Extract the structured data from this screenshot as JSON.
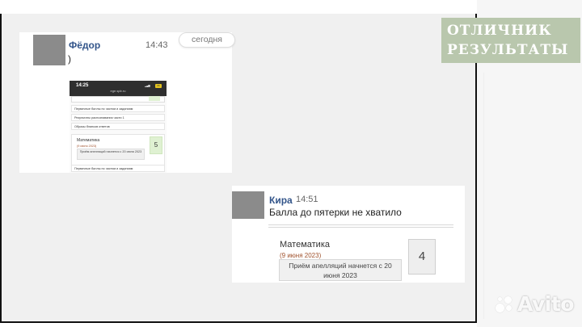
{
  "brand": {
    "line1": "ОТЛИЧНИК",
    "line2": "РЕЗУЛЬТАТЫ",
    "color": "#b9c7ad"
  },
  "message1": {
    "author": "Фёдор",
    "time": "14:43",
    "date_divider": "сегодня",
    "text": ")",
    "screenshot": {
      "status_time": "14:25",
      "url": "ege.spb.ru",
      "battery": "66",
      "rows": [
        "Первичные баллы по частям и заданиям",
        "Результаты распознавания части 1",
        "Образы бланков ответов"
      ],
      "subject": "Математика",
      "exam_date": "(9 июня 2023)",
      "appeal_note": "Приём апелляций начнется с 20 июня 2023",
      "grade": "5",
      "bottom_row": "Первичные баллы по частям и заданиям"
    }
  },
  "message2": {
    "author": "Кира",
    "time": "14:51",
    "text": "Балла до пятерки не хватило",
    "subject": "Математика",
    "exam_date": "(9 июня 2023)",
    "appeal_note": "Приём апелляций начнется с 20 июня 2023",
    "grade": "4"
  },
  "watermark": {
    "text": "Avito",
    "icon": "avito-logo-icon"
  }
}
